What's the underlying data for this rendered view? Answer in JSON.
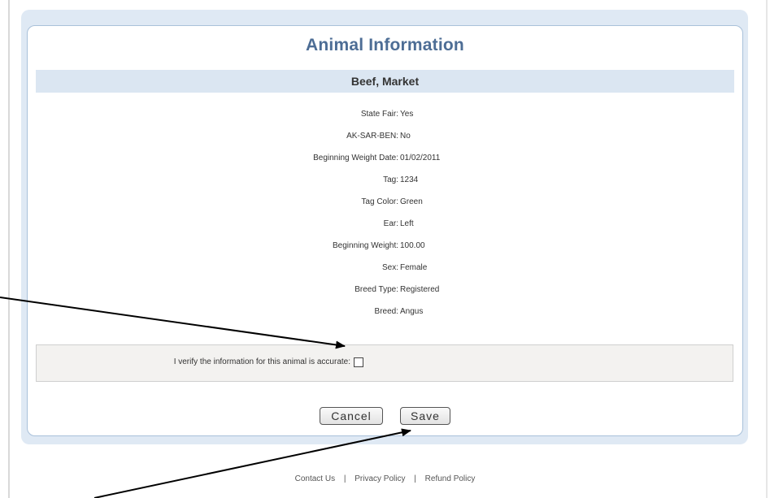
{
  "form": {
    "title": "Animal Information",
    "category": "Beef, Market",
    "fields": [
      {
        "label": "State Fair:",
        "value": "Yes"
      },
      {
        "label": "AK-SAR-BEN:",
        "value": "No"
      },
      {
        "label": "Beginning Weight Date:",
        "value": "01/02/2011"
      },
      {
        "label": "Tag:",
        "value": "1234"
      },
      {
        "label": "Tag Color:",
        "value": "Green"
      },
      {
        "label": "Ear:",
        "value": "Left"
      },
      {
        "label": "Beginning Weight:",
        "value": "100.00"
      },
      {
        "label": "Sex:",
        "value": "Female"
      },
      {
        "label": "Breed Type:",
        "value": "Registered"
      },
      {
        "label": "Breed:",
        "value": "Angus"
      }
    ],
    "verify_label": "I verify the information for this animal is accurate:",
    "verify_checked": false,
    "cancel_label": "Cancel",
    "save_label": "Save"
  },
  "footer": {
    "links": [
      "Contact Us",
      "Privacy Policy",
      "Refund Policy"
    ],
    "separator": "|"
  },
  "colors": {
    "title": "#4d6d95",
    "category_bar": "#dbe6f2",
    "outer_panel": "#dfe9f4"
  }
}
